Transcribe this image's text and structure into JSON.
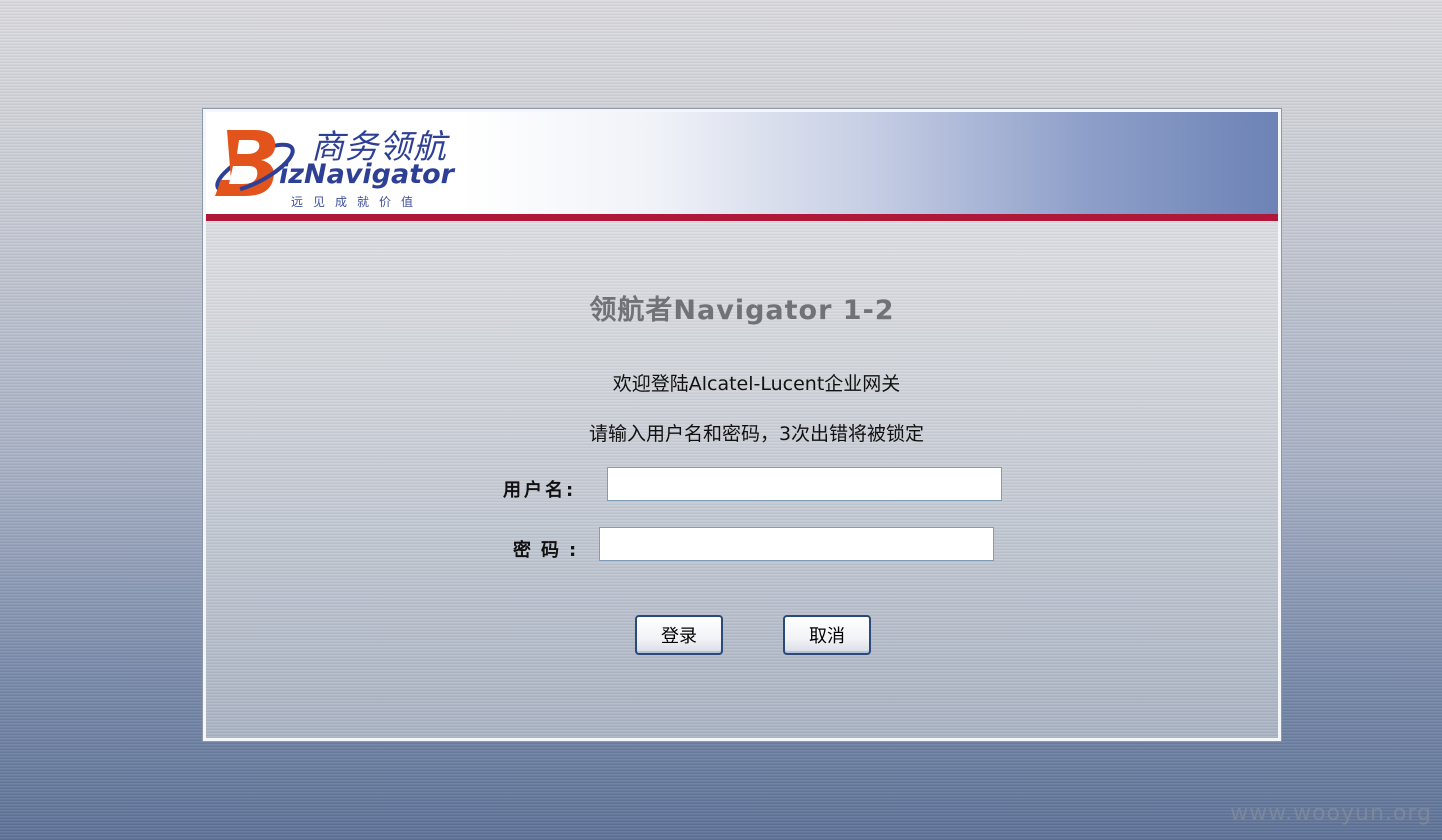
{
  "logo": {
    "cn_name": "商务领航",
    "en_name_prefix": "B",
    "en_name_rest": "izNavigator",
    "tagline": "远见成就价值"
  },
  "form": {
    "title": "领航者Navigator 1-2",
    "welcome": "欢迎登陆Alcatel-Lucent企业网关",
    "notice": "请输入用户名和密码，3次出错将被锁定",
    "username_label": "用户名:",
    "username_value": "",
    "password_label": "密码:",
    "password_value": "",
    "login_button": "登录",
    "cancel_button": "取消"
  },
  "watermark": "www.wooyun.org",
  "colors": {
    "banner_rule": "#b0183a",
    "logo_blue": "#2e3f96",
    "logo_orange": "#e2541b",
    "button_border": "#2b4a7c"
  },
  "icons": {
    "logo_mark": "biz-navigator-orbit-logo"
  }
}
